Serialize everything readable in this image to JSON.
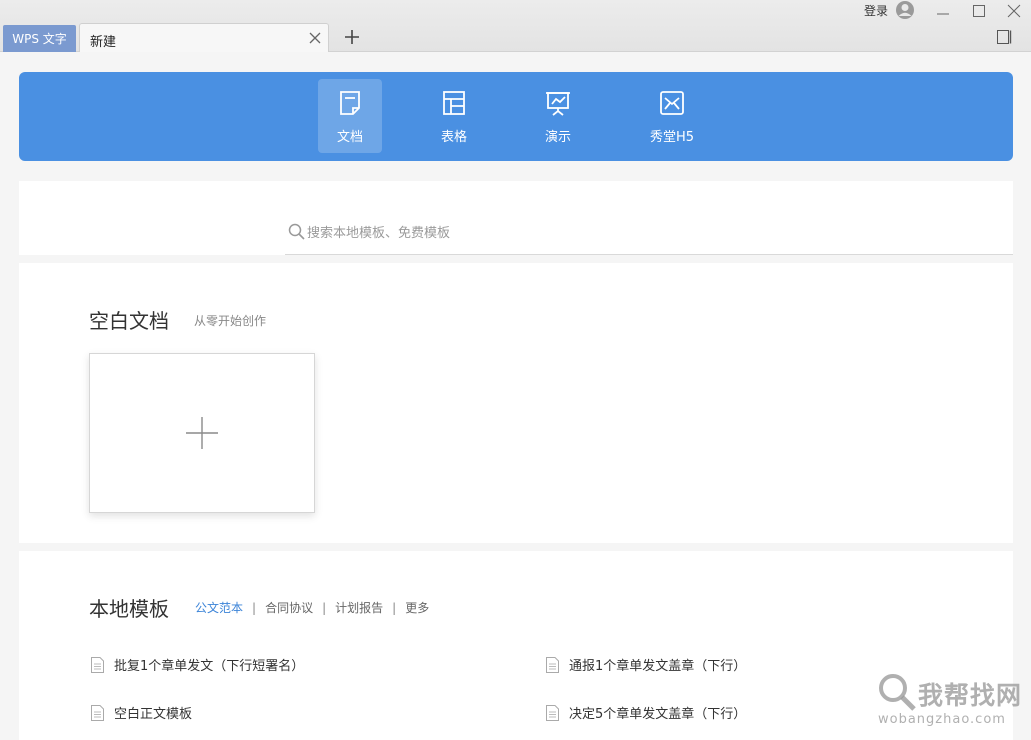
{
  "titlebar": {
    "app_tab": "WPS 文字",
    "doc_tab": "新建",
    "login": "登录"
  },
  "categories": [
    {
      "label": "文档",
      "icon": "document-icon",
      "active": true
    },
    {
      "label": "表格",
      "icon": "table-icon",
      "active": false
    },
    {
      "label": "演示",
      "icon": "presentation-icon",
      "active": false
    },
    {
      "label": "秀堂H5",
      "icon": "h5-icon",
      "active": false
    }
  ],
  "search": {
    "placeholder": "搜索本地模板、免费模板"
  },
  "blank": {
    "title": "空白文档",
    "subtitle": "从零开始创作"
  },
  "templates": {
    "title": "本地模板",
    "tabs": [
      "公文范本",
      "合同协议",
      "计划报告",
      "更多"
    ],
    "active_tab": "公文范本",
    "items": [
      "批复1个章单发文（下行短署名）",
      "通报1个章单发文盖章（下行）",
      "空白正文模板",
      "决定5个章单发文盖章（下行）"
    ]
  },
  "watermark": {
    "text": "我帮找网",
    "url": "wobangzhao.com"
  },
  "colors": {
    "accent": "#4a90e2",
    "app_tab": "#7b9ad0",
    "active_link": "#3c84d8"
  }
}
